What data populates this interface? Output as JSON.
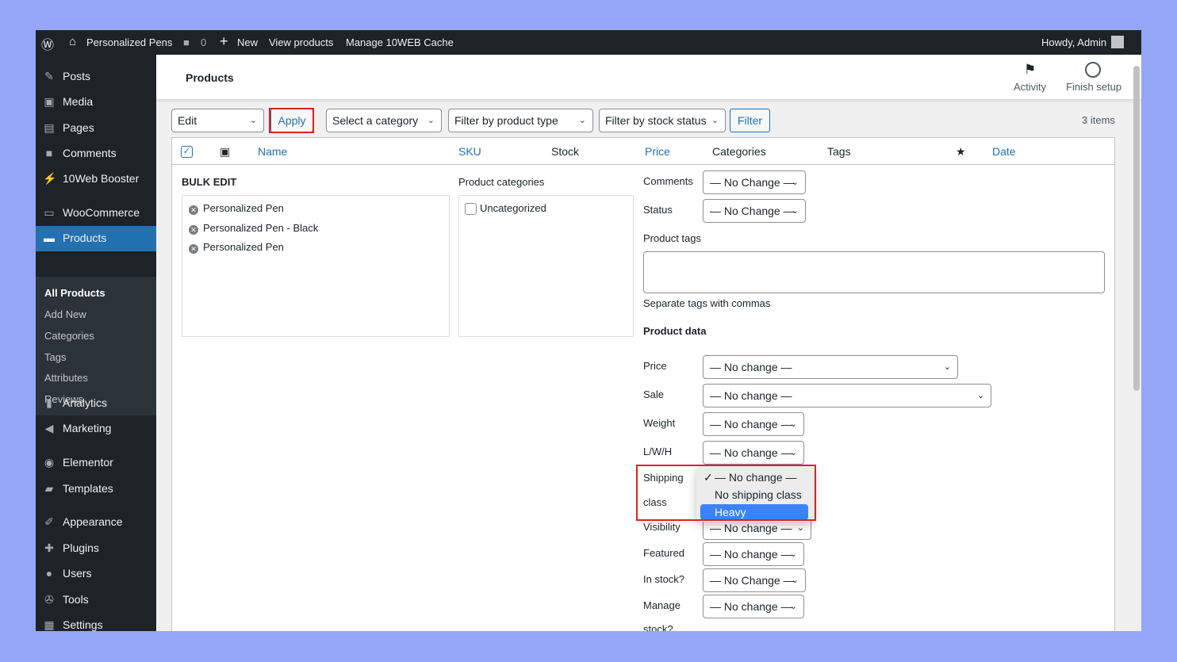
{
  "adminbar": {
    "site": "Personalized Pens",
    "comments": "0",
    "new": "New",
    "view": "View products",
    "cache": "Manage 10WEB Cache",
    "howdy": "Howdy, Admin"
  },
  "sidebar": {
    "items": [
      {
        "label": "Posts",
        "icon": "pin-icon"
      },
      {
        "label": "Media",
        "icon": "media-icon"
      },
      {
        "label": "Pages",
        "icon": "pages-icon"
      },
      {
        "label": "Comments",
        "icon": "comment-icon"
      },
      {
        "label": "10Web Booster",
        "icon": "booster-icon"
      },
      {
        "label": "WooCommerce",
        "icon": "woo-icon"
      },
      {
        "label": "Products",
        "icon": "products-icon"
      },
      {
        "label": "Analytics",
        "icon": "analytics-icon"
      },
      {
        "label": "Marketing",
        "icon": "megaphone-icon"
      },
      {
        "label": "Elementor",
        "icon": "elementor-icon"
      },
      {
        "label": "Templates",
        "icon": "folder-icon"
      },
      {
        "label": "Appearance",
        "icon": "brush-icon"
      },
      {
        "label": "Plugins",
        "icon": "plugin-icon"
      },
      {
        "label": "Users",
        "icon": "user-icon"
      },
      {
        "label": "Tools",
        "icon": "wrench-icon"
      },
      {
        "label": "Settings",
        "icon": "settings-icon"
      }
    ],
    "submenu": [
      "All Products",
      "Add New",
      "Categories",
      "Tags",
      "Attributes",
      "Reviews"
    ]
  },
  "header": {
    "title": "Products",
    "activity": "Activity",
    "finish": "Finish setup"
  },
  "toolbar": {
    "bulk": "Edit",
    "apply": "Apply",
    "category": "Select a category",
    "type": "Filter by product type",
    "stock": "Filter by stock status",
    "filter": "Filter",
    "count": "3 items"
  },
  "columns": {
    "name": "Name",
    "sku": "SKU",
    "stock": "Stock",
    "price": "Price",
    "categories": "Categories",
    "tags": "Tags",
    "date": "Date"
  },
  "bulk": {
    "title": "BULK EDIT",
    "products": [
      "Personalized Pen",
      "Personalized Pen - Black",
      "Personalized Pen"
    ],
    "cat_title": "Product categories",
    "cat_item": "Uncategorized",
    "comments_label": "Comments",
    "comments": "— No Change —",
    "status_label": "Status",
    "status": "— No Change —",
    "tags_label": "Product tags",
    "tags_hint": "Separate tags with commas",
    "data_title": "Product data",
    "fields": {
      "price_label": "Price",
      "price": "— No change —",
      "sale_label": "Sale",
      "sale": "— No change —",
      "weight_label": "Weight",
      "weight": "— No change —",
      "lwh_label": "L/W/H",
      "lwh": "— No change —",
      "shipping_label1": "Shipping",
      "shipping_label2": "class",
      "visibility_label": "Visibility",
      "visibility": "— No change —",
      "featured_label": "Featured",
      "featured": "— No change —",
      "instock_label": "In stock?",
      "instock": "— No Change —",
      "manage_label1": "Manage",
      "manage_label2": "stock?",
      "manage": "— No change —"
    },
    "shipping_options": [
      "— No change —",
      "No shipping class",
      "Heavy"
    ],
    "shipping_check": "✓"
  }
}
